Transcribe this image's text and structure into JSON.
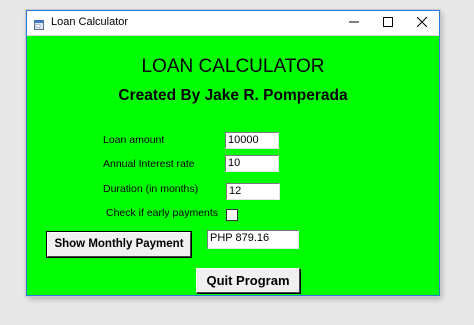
{
  "window": {
    "title": "Loan Calculator",
    "icon": "app-window-icon",
    "controls": [
      "minimize-icon",
      "maximize-icon",
      "close-icon"
    ]
  },
  "heading": {
    "title": "LOAN CALCULATOR",
    "subtitle": "Created By Jake R. Pomperada"
  },
  "form": {
    "loan_amount_label": "Loan amount",
    "loan_amount_value": "10000",
    "interest_label": "Annual Interest rate",
    "interest_value": "10",
    "duration_label": "Duration (in months)",
    "duration_value": "12",
    "early_payment_label": "Check if early payments",
    "early_payment_checked": false
  },
  "actions": {
    "show_label": "Show Monthly Payment",
    "result_value": "PHP 879.16",
    "quit_label": "Quit Program"
  },
  "colors": {
    "form_background": "#00ff00",
    "titlebar": "#ffffff",
    "button_face": "#f0f0f0"
  }
}
